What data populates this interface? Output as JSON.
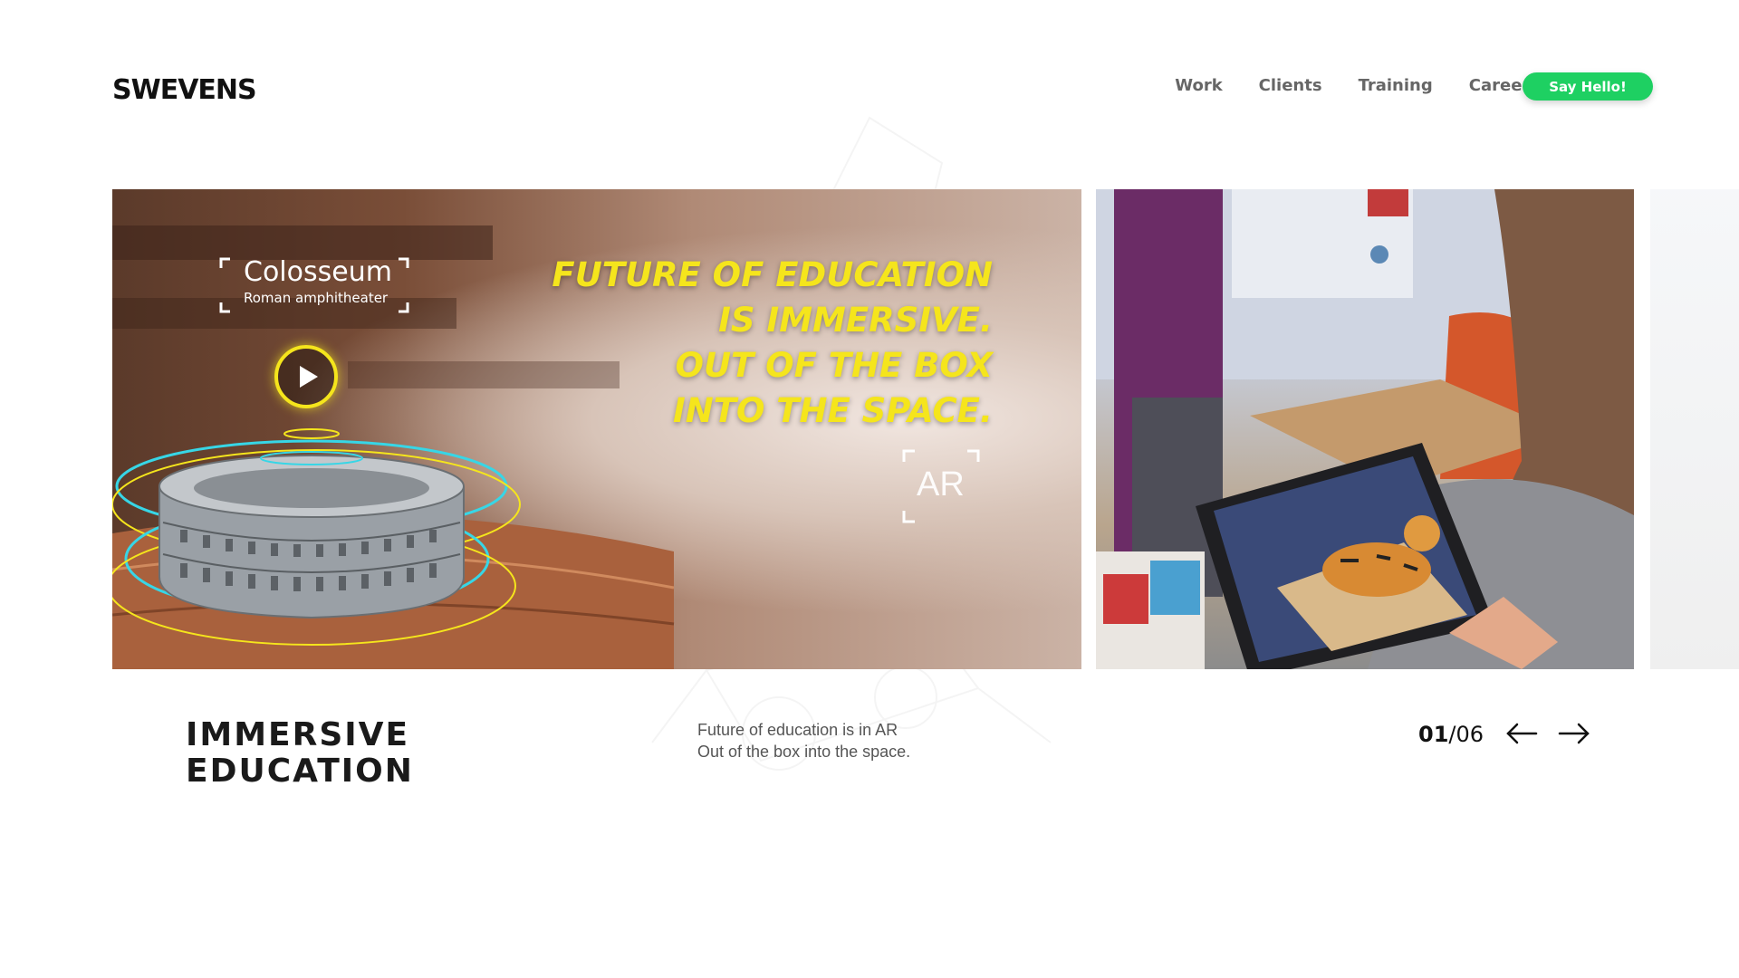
{
  "brand": {
    "logo": "SWEVENS"
  },
  "nav": {
    "items": [
      "Work",
      "Clients",
      "Training",
      "Careers"
    ],
    "cta": "Say Hello!"
  },
  "slider": {
    "slides": [
      {
        "headline_lines": [
          "FUTURE OF EDUCATION",
          "IS IMMERSIVE.",
          "OUT OF THE BOX",
          "INTO THE SPACE."
        ],
        "label_title": "Colosseum",
        "label_sub": "Roman amphitheater",
        "badge": "AR"
      },
      {
        "scene": "child using AR tablet with tiger card"
      }
    ],
    "title_lines": [
      "IMMERSIVE",
      "EDUCATION"
    ],
    "description_lines": [
      "Future of education is in AR",
      "Out of the box into the space."
    ],
    "counter": {
      "current": "01",
      "total": "/06"
    }
  },
  "colors": {
    "accent_green": "#1ed062",
    "headline_yellow": "#f5e51c",
    "hologram_cyan": "#37d6e6"
  }
}
